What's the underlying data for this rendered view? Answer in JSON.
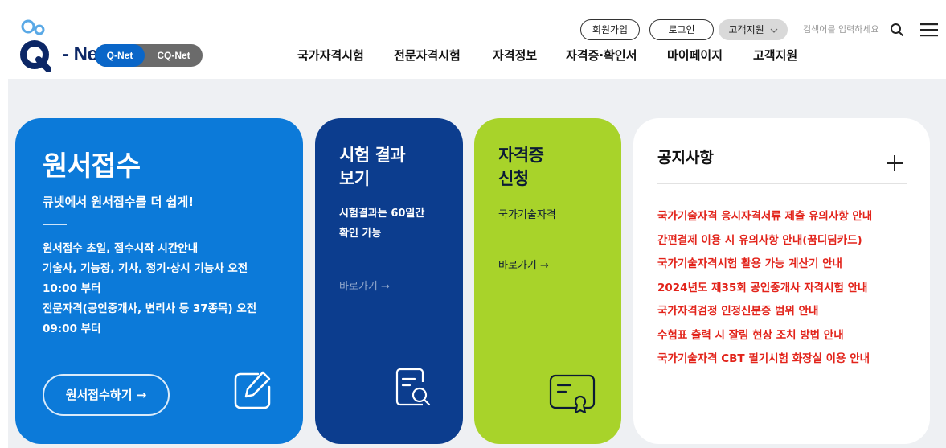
{
  "logo": {
    "text": "- Net",
    "switch_on": "Q-Net",
    "switch_off": "CQ-Net"
  },
  "util": {
    "signup": "회원가입",
    "login": "로그인",
    "support": "고객지원",
    "search_placeholder": "검색어를 입력하세요"
  },
  "gnb": {
    "items": [
      "국가자격시험",
      "전문자격시험",
      "자격정보",
      "자격증·확인서",
      "마이페이지",
      "고객지원"
    ]
  },
  "apply": {
    "title": "원서접수",
    "subtitle": "큐넷에서 원서접수를 더 쉽게!",
    "desc_lines": [
      "원서접수 초일, 접수시작 시간안내",
      "기술사, 기능장, 기사, 정기·상시 기능사 오전",
      "10:00 부터",
      "전문자격(공인중개사, 변리사 등 37종목) 오전",
      "09:00 부터"
    ],
    "button": "원서접수하기 →"
  },
  "result": {
    "title_1": "시험 결과",
    "title_2": "보기",
    "desc_1": "시험결과는 60일간",
    "desc_2": "확인 가능",
    "link": "바로가기 →"
  },
  "cert": {
    "title_1": "자격증",
    "title_2": "신청",
    "desc": "국가기술자격",
    "link": "바로가기 →"
  },
  "notice": {
    "title": "공지사항",
    "items": [
      "국가기술자격 응시자격서류 제출 유의사항 안내",
      "간편결제 이용 시 유의사항 안내(꿈디딤카드)",
      "국가기술자격시험 활용 가능 계산기 안내",
      "2024년도 제35회 공인중개사 자격시험 안내",
      "국가자격검정 인정신분증 범위 안내",
      "수험표 출력 시 잘림 현상 조치 방법 안내",
      "국가기술자격 CBT 필기시험 화장실 이용 안내"
    ]
  },
  "colors": {
    "primary_blue": "#0c7ad9",
    "navy": "#0c3d8e",
    "lime": "#a8d32a",
    "notice_red": "#e2231a"
  }
}
